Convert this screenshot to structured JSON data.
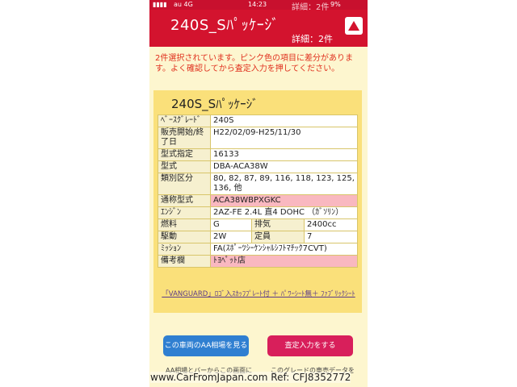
{
  "status": {
    "carrier": "au 4G",
    "time": "14:23",
    "battery": "9%"
  },
  "header": {
    "ghost_detail": "詳細：2件",
    "title": "240S_Sﾊﾟｯｹｰｼﾞ",
    "detail": "詳細：2件"
  },
  "notice": "2件選択されています。ピンク色の項目に差分があります。よく確認してから査定入力を押してください。",
  "card": {
    "title": "240S_Sﾊﾟｯｹｰｼﾞ",
    "rows": {
      "base_grade": {
        "label": "ﾍﾞｰｽｸﾞﾚｰﾄﾞ",
        "value": "240S"
      },
      "period": {
        "label": "販売開始/終了日",
        "value": "H22/02/09-H25/11/30"
      },
      "model_designation": {
        "label": "型式指定",
        "value": "16133"
      },
      "model": {
        "label": "型式",
        "value": "DBA-ACA38W"
      },
      "class": {
        "label": "類別区分",
        "value": "80, 82, 87, 89, 116, 118, 123, 125, 136, 他"
      },
      "common_model": {
        "label": "通称型式",
        "value": "ACA38WBPXGKC"
      },
      "engine": {
        "label": "ｴﾝｼﾞﾝ",
        "value": "2AZ-FE 2.4L 直4 DOHC （ｶﾞｿﾘﾝ）"
      },
      "fuel": {
        "label": "燃料",
        "value": "G",
        "label2": "排気",
        "value2": "2400cc"
      },
      "drive": {
        "label": "駆動",
        "value": "2W",
        "label2": "定員",
        "value2": "7"
      },
      "transmission": {
        "label": "ﾐｯｼｮﾝ",
        "value": "FA(ｽﾎﾟｰﾂｼｰｹﾝｼｬﾙｼﾌﾄﾏﾁｯｸ7CVT)"
      },
      "remarks": {
        "label": "備考欄",
        "value": "ﾄﾖﾍﾟｯﾄ店"
      }
    },
    "options": "「VANGUARD」ﾛｺﾞ入ｽｶｯﾌﾌﾟﾚｰﾄ付 ＋ ﾊﾟﾜｰｼｰﾄ無＋ ﾌｧﾌﾞﾘｯｸｼｰﾄ"
  },
  "buttons": {
    "market": "この車両のAA相場を見る",
    "assess": "査定入力をする"
  },
  "cutoff": {
    "left": "AA相場とバーからこの画面に",
    "right": "このグレードの車売データを"
  },
  "watermark": "www.CarFromJapan.com Ref: CFJ8352772",
  "colors": {
    "header_red": "#d3132e",
    "notice_red": "#e0301e",
    "pink_diff": "#f9b8c0",
    "card_yellow": "#fae07a"
  },
  "icons": {
    "up": "triangle-up-icon"
  }
}
